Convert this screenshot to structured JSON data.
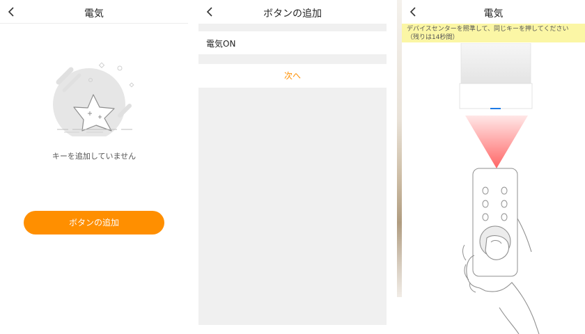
{
  "panel1": {
    "header": {
      "title": "電気"
    },
    "empty_message": "キーを追加していません",
    "add_button_label": "ボタンの追加"
  },
  "panel2": {
    "header": {
      "title": "ボタンの追加"
    },
    "items": [
      {
        "label": "電気ON"
      }
    ],
    "next_label": "次へ"
  },
  "panel3": {
    "header": {
      "title": "電気"
    },
    "notice": {
      "line1": "デバイスセンターを照準して、同じキーを押してください",
      "line2": "（残りは14秒間）"
    }
  },
  "colors": {
    "accent": "#ff8f00",
    "notice_bg": "#fbf6a5",
    "panel_bg": "#f0f0f0",
    "led": "#1e7be6"
  },
  "icons": [
    "back-chevron-icon",
    "empty-star-illustration",
    "remote-aim-illustration"
  ]
}
